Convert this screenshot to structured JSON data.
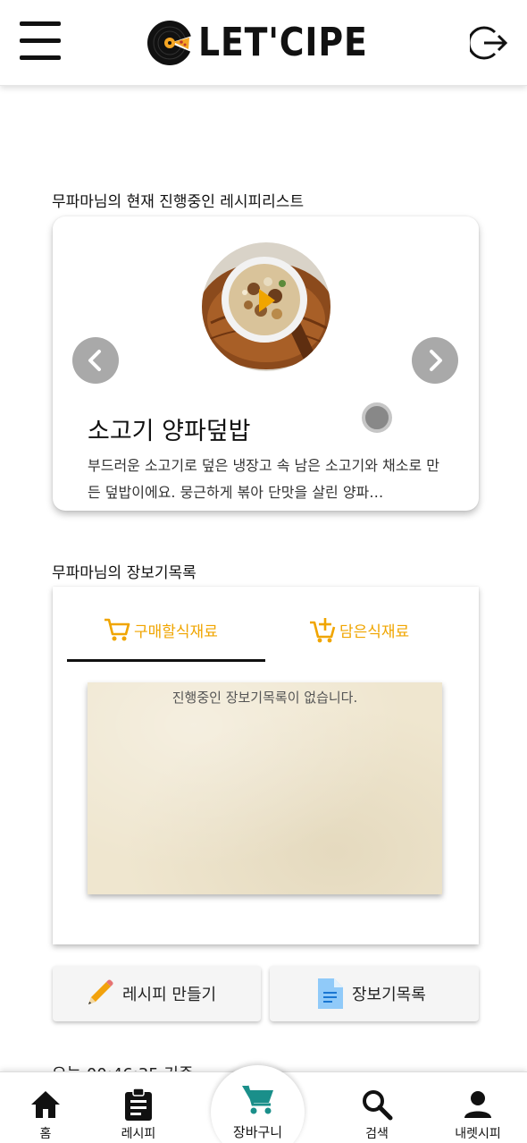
{
  "header": {
    "menu_icon": "hamburger-menu-icon",
    "logo_text": "LET'CIPE",
    "logout_icon": "logout-icon"
  },
  "current_recipes": {
    "section_title": "무파마님의 현재 진행중인 레시피리스트",
    "recipe": {
      "title": "소고기 양파덮밥",
      "description": "부드러운 소고기로 덮은 냉장고 속 남은 소고기와 채소로 만든 덮밥이에요. 뭉근하게 볶아 단맛을 살린 양파…"
    },
    "prev_icon": "chevron-left-icon",
    "next_icon": "chevron-right-icon"
  },
  "shopping": {
    "section_title": "무파마님의 장보기목록",
    "tabs": [
      {
        "label": "구매할식재료",
        "icon": "cart-icon",
        "active": true
      },
      {
        "label": "담은식재료",
        "icon": "cart-plus-icon",
        "active": false
      }
    ],
    "empty_message": "진행중인 장보기목록이 없습니다."
  },
  "actions": {
    "make_recipe": "레시피 만들기",
    "shopping_list": "장보기목록"
  },
  "timestamp": "오늘 00:46:35 기준",
  "bottom_nav": {
    "home": "홈",
    "recipe": "레시피",
    "cart": "장바구니",
    "search": "검색",
    "mine": "내렛시피"
  },
  "colors": {
    "accent": "#f0a500",
    "cart_teal": "#1a8f8a",
    "arrow_bg": "#a9a9a9"
  }
}
